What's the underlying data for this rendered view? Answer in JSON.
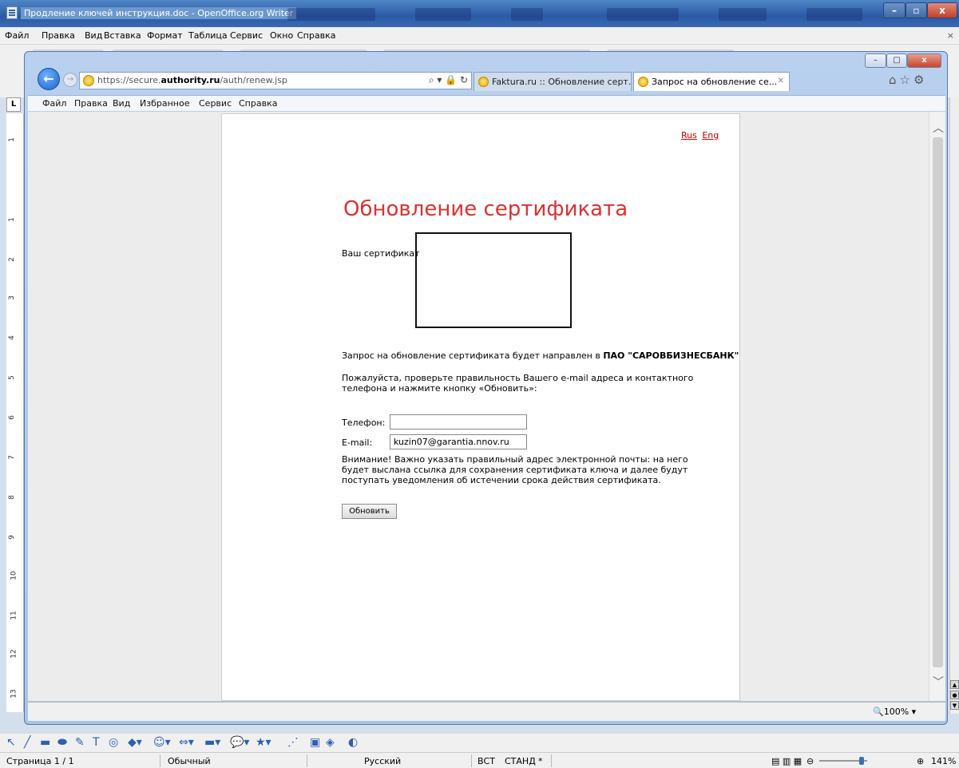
{
  "writer": {
    "title": "Продление ключей инструкция.doc - OpenOffice.org Writer",
    "menu": [
      "Файл",
      "Правка",
      "Вид",
      "Вставка",
      "Формат",
      "Таблица",
      "Сервис",
      "Окно",
      "Справка"
    ],
    "ruler_corner": "L",
    "ruler_numbers": [
      "1",
      "1",
      "2",
      "3",
      "4",
      "5",
      "6",
      "7",
      "8",
      "9",
      "10",
      "11",
      "12",
      "13"
    ],
    "status": {
      "page": "Страница 1 / 1",
      "style": "Обычный",
      "language": "Русский",
      "insert": "ВСТ",
      "selection": "СТАНД",
      "modified": "*",
      "zoom": "141%"
    }
  },
  "browser": {
    "url_prefix": "https://secure.",
    "url_domain": "authority.ru",
    "url_path": "/auth/renew.jsp",
    "tabs": [
      {
        "label": "Faktura.ru :: Обновление серт...",
        "active": false
      },
      {
        "label": "Запрос на обновление се...",
        "active": true
      }
    ],
    "menu": [
      "Файл",
      "Правка",
      "Вид",
      "Избранное",
      "Сервис",
      "Справка"
    ],
    "zoom": "100%"
  },
  "page": {
    "lang_rus": "Rus",
    "lang_eng": "Eng",
    "heading": "Обновление сертификата",
    "cert_label": "Ваш сертификат",
    "request_text": "Запрос на обновление сертификата будет направлен в ",
    "bank_name": "ПАО \"САРОВБИЗНЕСБАНК\"",
    "instructions": "Пожалуйста, проверьте правильность Вашего e-mail адреса и контактного телефона и нажмите кнопку «Обновить»:",
    "phone_label": "Телефон:",
    "phone_value": "",
    "email_label": "E-mail:",
    "email_value": "kuzin07@garantia.nnov.ru",
    "warning": "Внимание! Важно указать правильный адрес электронной почты: на него будет выслана ссылка для сохранения сертификата ключа и далее будут поступать уведомления об истечении срока действия сертификата.",
    "update_button": "Обновить"
  },
  "colors": {
    "heading": "#e03030",
    "link": "#cc0000",
    "titlebar": "#2b5aa6"
  }
}
